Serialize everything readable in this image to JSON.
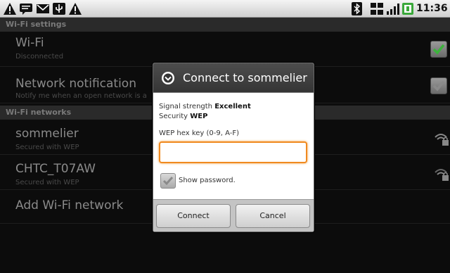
{
  "status_bar": {
    "left_icons": [
      "warning-icon",
      "chat-icon",
      "mail-icon",
      "usb-icon",
      "warning-icon"
    ],
    "right_icons": [
      "bluetooth-icon",
      "network-icon",
      "signal-icon",
      "battery-icon"
    ],
    "time": "11:36 ar"
  },
  "settings": {
    "section_wifi_settings": "Wi-Fi settings",
    "wifi": {
      "title": "Wi-Fi",
      "subtitle": "Disconnected",
      "checked": true
    },
    "network_notification": {
      "title": "Network notification",
      "subtitle": "Notify me when an open network is a",
      "checked": false
    },
    "section_wifi_networks": "Wi-Fi networks",
    "networks": [
      {
        "name": "sommelier",
        "subtitle": "Secured with WEP"
      },
      {
        "name": "CHTC_T07AW",
        "subtitle": "Secured with WEP"
      }
    ],
    "add_network": "Add Wi-Fi network"
  },
  "dialog": {
    "title": "Connect to sommelier",
    "signal_label": "Signal strength",
    "signal_value": "Excellent",
    "security_label": "Security",
    "security_value": "WEP",
    "key_label": "WEP hex key (0-9, A-F)",
    "key_value": "",
    "show_password_label": "Show password.",
    "show_password_checked": true,
    "connect_label": "Connect",
    "cancel_label": "Cancel"
  },
  "colors": {
    "accent_focus": "#f08a20",
    "checkbox_green": "#3cb33c"
  }
}
